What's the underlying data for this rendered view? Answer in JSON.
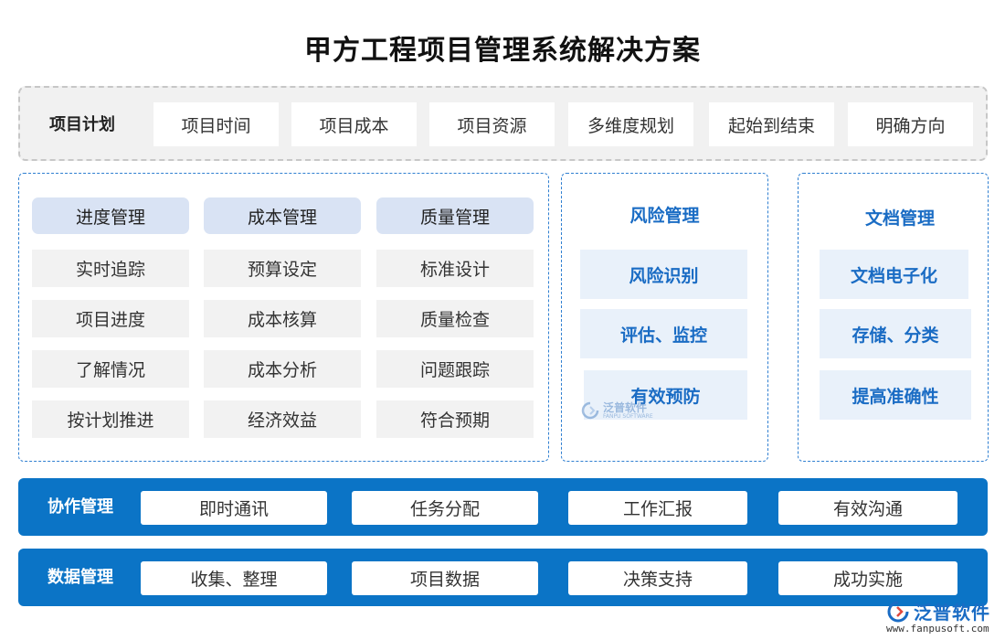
{
  "title": "甲方工程项目管理系统解决方案",
  "plan": {
    "label": "项目计划",
    "items": [
      "项目时间",
      "项目成本",
      "项目资源",
      "多维度规划",
      "起始到结束",
      "明确方向"
    ]
  },
  "main_grid": {
    "columns": [
      {
        "header": "进度管理",
        "items": [
          "实时追踪",
          "项目进度",
          "了解情况",
          "按计划推进"
        ]
      },
      {
        "header": "成本管理",
        "items": [
          "预算设定",
          "成本核算",
          "成本分析",
          "经济效益"
        ]
      },
      {
        "header": "质量管理",
        "items": [
          "标准设计",
          "质量检查",
          "问题跟踪",
          "符合预期"
        ]
      }
    ]
  },
  "risk": {
    "title": "风险管理",
    "items": [
      "风险识别",
      "评估、监控",
      "有效预防"
    ]
  },
  "docs": {
    "title": "文档管理",
    "items": [
      "文档电子化",
      "存储、分类",
      "提高准确性"
    ]
  },
  "collab": {
    "label": "协作管理",
    "items": [
      "即时通讯",
      "任务分配",
      "工作汇报",
      "有效沟通"
    ]
  },
  "data_mgmt": {
    "label": "数据管理",
    "items": [
      "收集、整理",
      "项目数据",
      "决策支持",
      "成功实施"
    ]
  },
  "watermark": {
    "name": "泛普软件",
    "sub": "FANPU SOFTWARE"
  },
  "brand": {
    "name": "泛普软件",
    "url": "www.fanpusoft.com"
  },
  "colors": {
    "accent": "#0b74c6",
    "accent_text": "#1a6cc4",
    "header_fill": "#d9e3f4",
    "cell_fill": "#f2f2f2",
    "side_fill": "#e9f1fa"
  }
}
